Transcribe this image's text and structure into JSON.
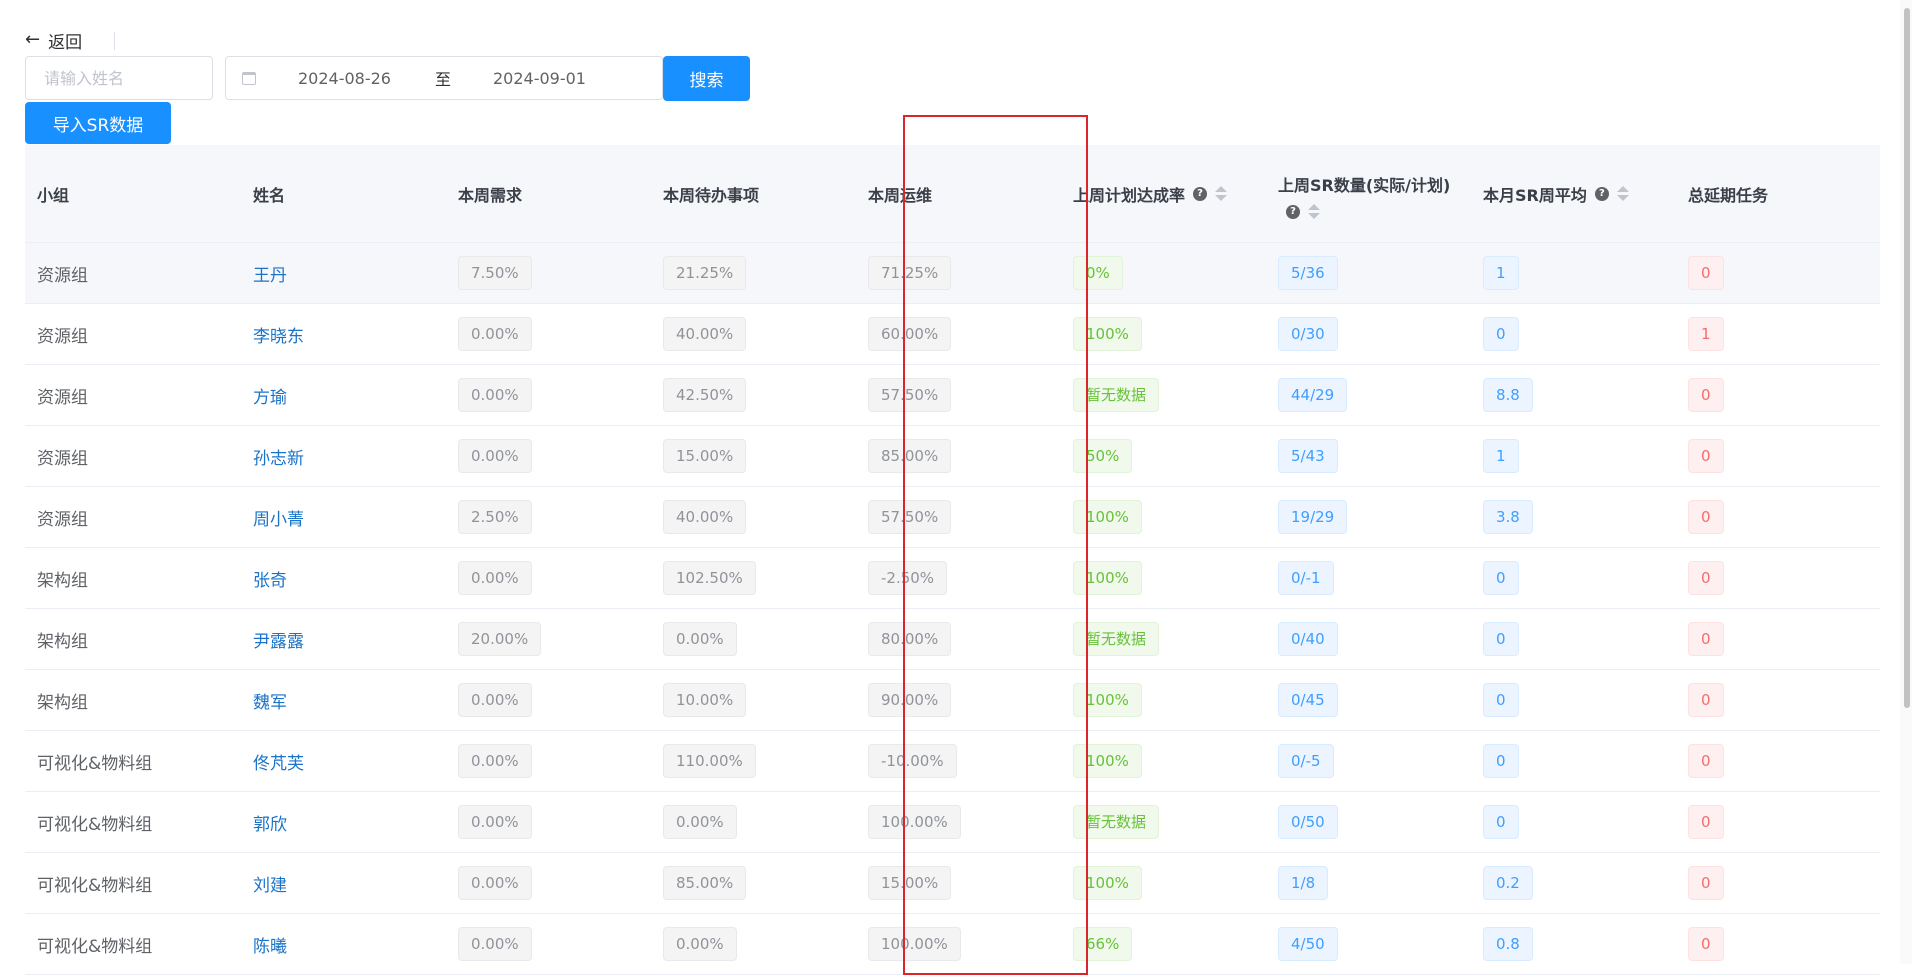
{
  "header": {
    "back_label": "返回"
  },
  "filters": {
    "name_placeholder": "请输入姓名",
    "date_start": "2024-08-26",
    "date_separator": "至",
    "date_end": "2024-09-01",
    "search_label": "搜索",
    "import_label": "导入SR数据"
  },
  "table": {
    "columns": [
      "小组",
      "姓名",
      "本周需求",
      "本周待办事项",
      "本周运维",
      "上周计划达成率",
      "上周SR数量(实际/计划)",
      "本月SR周平均",
      "总延期任务"
    ],
    "rows": [
      {
        "group": "资源组",
        "name": "王丹",
        "demand": "7.50%",
        "todo": "21.25%",
        "ops": "71.25%",
        "plan_rate": "0%",
        "sr_count": "5/36",
        "sr_avg": "1",
        "delayed": "0"
      },
      {
        "group": "资源组",
        "name": "李晓东",
        "demand": "0.00%",
        "todo": "40.00%",
        "ops": "60.00%",
        "plan_rate": "100%",
        "sr_count": "0/30",
        "sr_avg": "0",
        "delayed": "1"
      },
      {
        "group": "资源组",
        "name": "方瑜",
        "demand": "0.00%",
        "todo": "42.50%",
        "ops": "57.50%",
        "plan_rate": "暂无数据",
        "sr_count": "44/29",
        "sr_avg": "8.8",
        "delayed": "0"
      },
      {
        "group": "资源组",
        "name": "孙志新",
        "demand": "0.00%",
        "todo": "15.00%",
        "ops": "85.00%",
        "plan_rate": "50%",
        "sr_count": "5/43",
        "sr_avg": "1",
        "delayed": "0"
      },
      {
        "group": "资源组",
        "name": "周小菁",
        "demand": "2.50%",
        "todo": "40.00%",
        "ops": "57.50%",
        "plan_rate": "100%",
        "sr_count": "19/29",
        "sr_avg": "3.8",
        "delayed": "0"
      },
      {
        "group": "架构组",
        "name": "张奇",
        "demand": "0.00%",
        "todo": "102.50%",
        "ops": "-2.50%",
        "plan_rate": "100%",
        "sr_count": "0/-1",
        "sr_avg": "0",
        "delayed": "0"
      },
      {
        "group": "架构组",
        "name": "尹露露",
        "demand": "20.00%",
        "todo": "0.00%",
        "ops": "80.00%",
        "plan_rate": "暂无数据",
        "sr_count": "0/40",
        "sr_avg": "0",
        "delayed": "0"
      },
      {
        "group": "架构组",
        "name": "魏军",
        "demand": "0.00%",
        "todo": "10.00%",
        "ops": "90.00%",
        "plan_rate": "100%",
        "sr_count": "0/45",
        "sr_avg": "0",
        "delayed": "0"
      },
      {
        "group": "可视化&物料组",
        "name": "佟芃芙",
        "demand": "0.00%",
        "todo": "110.00%",
        "ops": "-10.00%",
        "plan_rate": "100%",
        "sr_count": "0/-5",
        "sr_avg": "0",
        "delayed": "0"
      },
      {
        "group": "可视化&物料组",
        "name": "郭欣",
        "demand": "0.00%",
        "todo": "0.00%",
        "ops": "100.00%",
        "plan_rate": "暂无数据",
        "sr_count": "0/50",
        "sr_avg": "0",
        "delayed": "0"
      },
      {
        "group": "可视化&物料组",
        "name": "刘建",
        "demand": "0.00%",
        "todo": "85.00%",
        "ops": "15.00%",
        "plan_rate": "100%",
        "sr_count": "1/8",
        "sr_avg": "0.2",
        "delayed": "0"
      },
      {
        "group": "可视化&物料组",
        "name": "陈曦",
        "demand": "0.00%",
        "todo": "0.00%",
        "ops": "100.00%",
        "plan_rate": "66%",
        "sr_count": "4/50",
        "sr_avg": "0.8",
        "delayed": "0"
      }
    ]
  },
  "colors": {
    "primary": "#1890ff",
    "name_link": "#1a73c8",
    "highlight_box": "#d9252b"
  }
}
